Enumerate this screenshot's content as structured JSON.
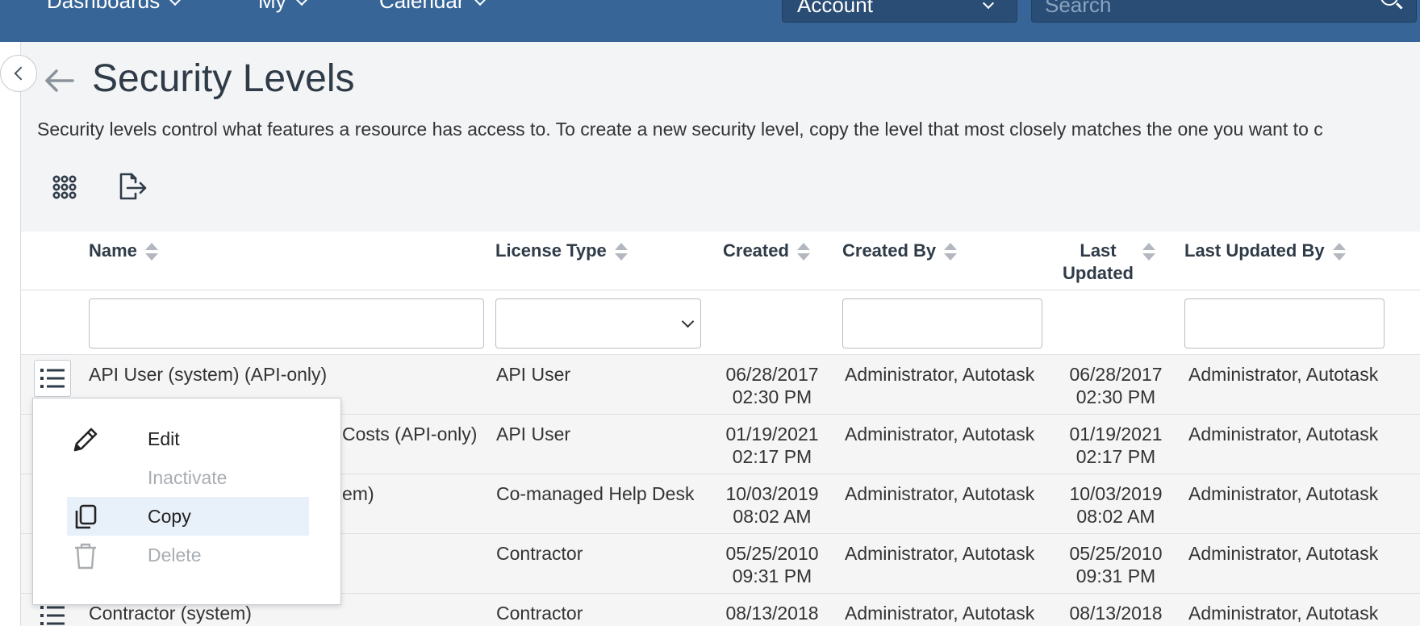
{
  "nav": {
    "items": [
      {
        "label": "Dashboards"
      },
      {
        "label": "My"
      },
      {
        "label": "Calendar"
      }
    ],
    "account_select": "Account",
    "search_placeholder": "Search"
  },
  "header": {
    "title": "Security Levels",
    "description": "Security levels control what features a resource has access to. To create a new security level, copy the level that most closely matches the one you want to c"
  },
  "toolbar": {
    "icons": [
      "column-chooser-icon",
      "export-icon"
    ]
  },
  "table": {
    "columns": [
      {
        "label": "Name"
      },
      {
        "label": "License Type"
      },
      {
        "label": "Created"
      },
      {
        "label": "Created By"
      },
      {
        "label": "Last Updated"
      },
      {
        "label": "Last Updated By"
      }
    ],
    "rows": [
      {
        "name": "API User (system) (API-only)",
        "license": "API User",
        "created_date": "06/28/2017",
        "created_time": "02:30 PM",
        "created_by": "Administrator, Autotask",
        "updated_date": "06/28/2017",
        "updated_time": "02:30 PM",
        "updated_by": "Administrator, Autotask"
      },
      {
        "name": "Costs (API-only)",
        "license": "API User",
        "created_date": "01/19/2021",
        "created_time": "02:17 PM",
        "created_by": "Administrator, Autotask",
        "updated_date": "01/19/2021",
        "updated_time": "02:17 PM",
        "updated_by": "Administrator, Autotask"
      },
      {
        "name": "em)",
        "license": "Co-managed Help Desk",
        "created_date": "10/03/2019",
        "created_time": "08:02 AM",
        "created_by": "Administrator, Autotask",
        "updated_date": "10/03/2019",
        "updated_time": "08:02 AM",
        "updated_by": "Administrator, Autotask"
      },
      {
        "name": "",
        "license": "Contractor",
        "created_date": "05/25/2010",
        "created_time": "09:31 PM",
        "created_by": "Administrator, Autotask",
        "updated_date": "05/25/2010",
        "updated_time": "09:31 PM",
        "updated_by": "Administrator, Autotask"
      },
      {
        "name": "Contractor (system)",
        "license": "Contractor",
        "created_date": "08/13/2018",
        "created_time": "",
        "created_by": "Administrator, Autotask",
        "updated_date": "08/13/2018",
        "updated_time": "",
        "updated_by": "Administrator, Autotask"
      }
    ]
  },
  "context_menu": {
    "items": [
      {
        "label": "Edit",
        "icon": "pencil-icon",
        "state": "enabled"
      },
      {
        "label": "Inactivate",
        "icon": "",
        "state": "disabled"
      },
      {
        "label": "Copy",
        "icon": "copy-icon",
        "state": "highlighted"
      },
      {
        "label": "Delete",
        "icon": "trash-icon",
        "state": "disabled"
      }
    ]
  },
  "colors": {
    "nav_bg": "#376597",
    "highlight": "#e8f0fa"
  }
}
